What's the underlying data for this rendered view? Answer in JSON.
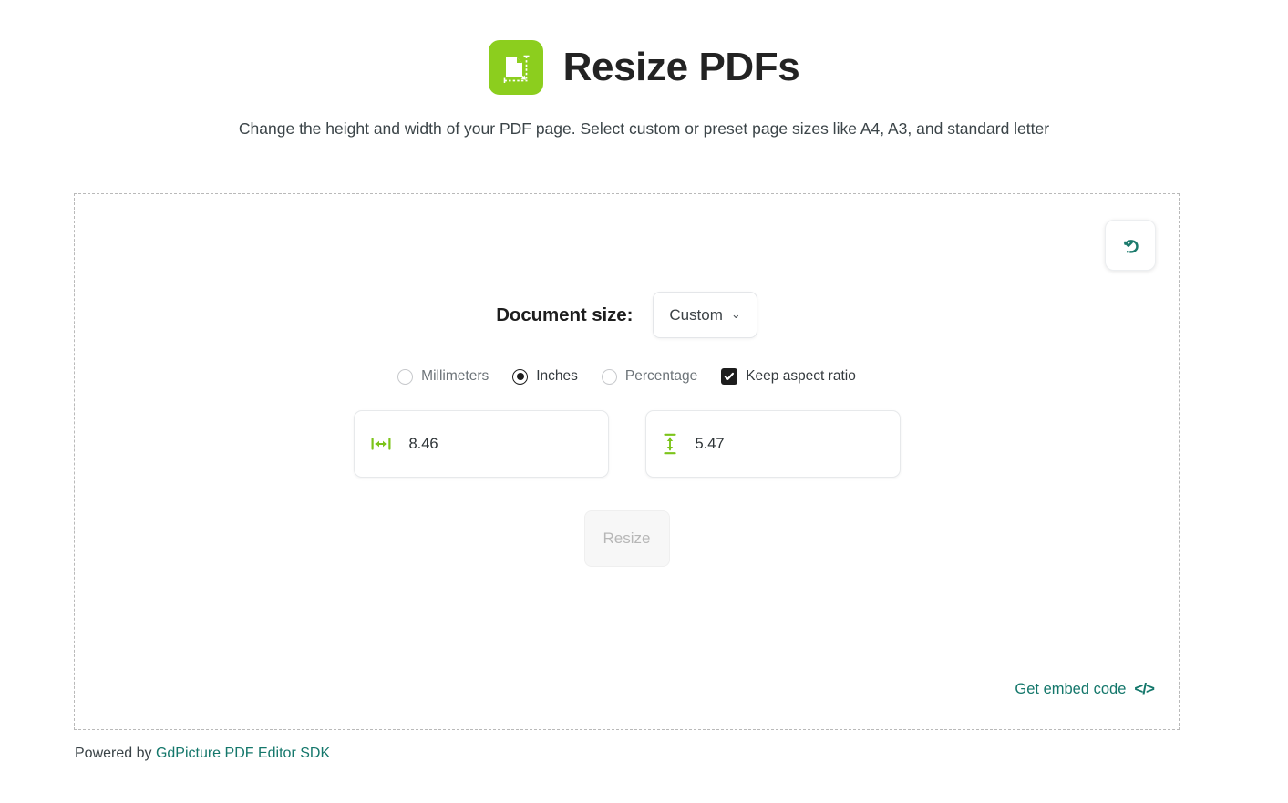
{
  "header": {
    "logo_icon": "resize-page-icon",
    "title": "Resize PDFs",
    "subtitle": "Change the height and width of your PDF page. Select custom or preset page sizes like A4, A3, and standard letter"
  },
  "panel": {
    "undo_icon": "undo-arrow-icon",
    "document_size": {
      "label": "Document size:",
      "selected": "Custom",
      "chevron": "⌄"
    },
    "units": [
      {
        "label": "Millimeters",
        "selected": false
      },
      {
        "label": "Inches",
        "selected": true
      },
      {
        "label": "Percentage",
        "selected": false
      }
    ],
    "keep_aspect_ratio": {
      "label": "Keep aspect ratio",
      "checked": true,
      "check_glyph": "✔"
    },
    "width_field": {
      "icon": "width-arrows-icon",
      "value": "8.46",
      "placeholder": "Width"
    },
    "height_field": {
      "icon": "height-arrows-icon",
      "value": "5.47",
      "placeholder": "Height"
    },
    "resize_button": {
      "label": "Resize",
      "disabled": true
    },
    "embed": {
      "label": "Get embed code",
      "glyph": "</>"
    }
  },
  "footer": {
    "prefix": "Powered by ",
    "link": "GdPicture PDF Editor SDK"
  },
  "colors": {
    "brand_green": "#8cce1e",
    "accent_teal": "#14776b",
    "text_dark": "#232323",
    "text_muted": "#6c7378"
  }
}
